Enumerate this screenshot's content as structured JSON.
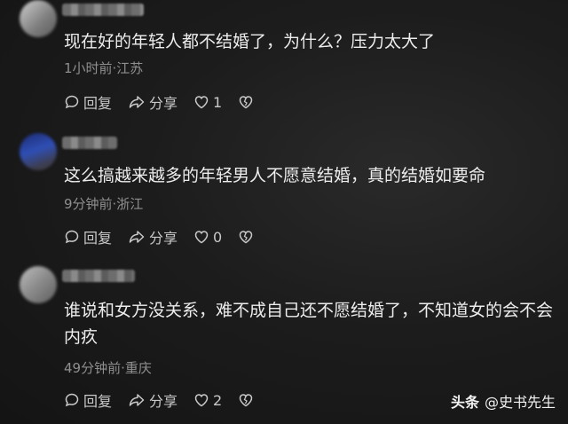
{
  "comments": [
    {
      "text": "现在好的年轻人都不结婚了，为什么？压力太大了",
      "meta": "1小时前·江苏",
      "reply_label": "回复",
      "share_label": "分享",
      "likes": "1"
    },
    {
      "text": "这么搞越来越多的年轻男人不愿意结婚，真的结婚如要命",
      "meta": "9分钟前·浙江",
      "reply_label": "回复",
      "share_label": "分享",
      "likes": "0"
    },
    {
      "text": "谁说和女方没关系，难不成自己还不愿结婚了，不知道女的会不会内疚",
      "meta": "49分钟前·重庆",
      "reply_label": "回复",
      "share_label": "分享",
      "likes": "2"
    }
  ],
  "watermark": {
    "logo": "头条",
    "handle": "@史书先生"
  },
  "icons": [
    "comment-icon",
    "share-icon",
    "heart-icon",
    "dislike-icon"
  ]
}
